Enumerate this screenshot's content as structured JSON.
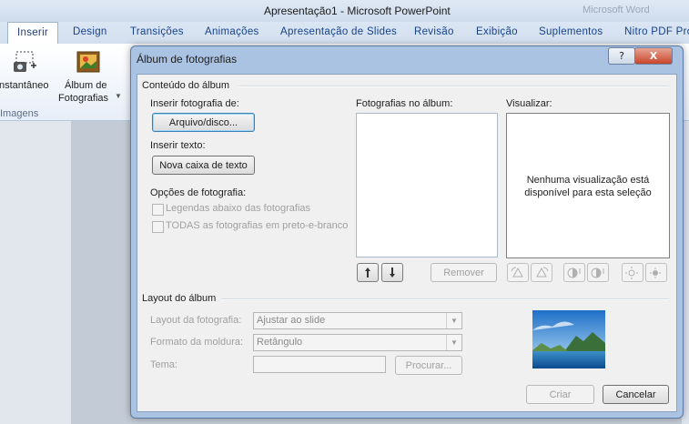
{
  "app": {
    "window_title": "Apresentação1 - Microsoft PowerPoint",
    "ghost_text": "Microsoft Word"
  },
  "ribbon": {
    "tabs": [
      {
        "label": "Inserir",
        "active": true
      },
      {
        "label": "Design"
      },
      {
        "label": "Transições"
      },
      {
        "label": "Animações"
      },
      {
        "label": "Apresentação de Slides"
      },
      {
        "label": "Revisão"
      },
      {
        "label": "Exibição"
      },
      {
        "label": "Suplementos"
      },
      {
        "label": "Nitro PDF Pro"
      }
    ],
    "instantaneo_label": "nstantâneo",
    "album_label_1": "Álbum de",
    "album_label_2": "Fotografias",
    "group_label": "Imagens"
  },
  "dialog": {
    "title": "Álbum de fotografias",
    "help_label": "?",
    "close_label": "X",
    "album_content": {
      "section_title": "Conteúdo do álbum",
      "insert_photo_label": "Inserir fotografia de:",
      "file_disk_button": "Arquivo/disco...",
      "insert_text_label": "Inserir texto:",
      "new_textbox_button": "Nova caixa de texto",
      "photo_options_label": "Opções de fotografia:",
      "captions_label": "Legendas abaixo das fotografias",
      "bw_label": "TODAS as fotografias em preto-e-branco",
      "photos_in_album_label": "Fotografias no álbum:",
      "preview_label": "Visualizar:",
      "preview_message": "Nenhuma visualização está disponível para esta seleção",
      "remove_button": "Remover"
    },
    "album_layout": {
      "section_title": "Layout do álbum",
      "photo_layout_label": "Layout da fotografia:",
      "photo_layout_value": "Ajustar ao slide",
      "frame_shape_label": "Formato da moldura:",
      "frame_shape_value": "Retângulo",
      "theme_label": "Tema:",
      "browse_button": "Procurar..."
    },
    "create_button": "Criar",
    "cancel_button": "Cancelar"
  },
  "colors": {
    "dialog_frame": "#aac3e2",
    "client_bg": "#f0f0f0",
    "tab_text": "#15428b"
  }
}
